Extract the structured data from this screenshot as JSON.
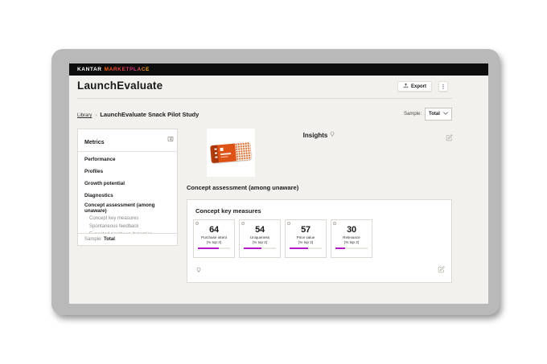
{
  "topbar": {
    "brand_primary": "KANTAR",
    "brand_secondary": "MARKETPLACE"
  },
  "header": {
    "title": "LaunchEvaluate",
    "export_label": "Export",
    "menu_glyph": "⋮"
  },
  "breadcrumb": {
    "library": "Library",
    "separator": "›",
    "current": "LaunchEvaluate Snack Pilot Study"
  },
  "sample_selector": {
    "label": "Sample:",
    "value": "Total"
  },
  "sidebar": {
    "title": "Metrics",
    "items": [
      {
        "label": "Performance"
      },
      {
        "label": "Profiles"
      },
      {
        "label": "Growth potential"
      },
      {
        "label": "Diagnostics"
      },
      {
        "label": "Concept assessment (among unaware)"
      }
    ],
    "subitems": [
      "Concept key measures",
      "Spontaneous feedback",
      "Expected purchase dynamics"
    ],
    "sample_label": "Sample:",
    "sample_value": "Total"
  },
  "insights": {
    "title": "Insights"
  },
  "section": {
    "heading": "Concept assessment (among unaware)"
  },
  "key_measures": {
    "heading": "Concept key measures",
    "metrics": [
      {
        "value": "64",
        "label": "Purchase intent",
        "sublabel": "(% top 2)",
        "pct": 64
      },
      {
        "value": "54",
        "label": "Uniqueness",
        "sublabel": "(% top 2)",
        "pct": 54
      },
      {
        "value": "57",
        "label": "Price value",
        "sublabel": "(% top 2)",
        "pct": 57
      },
      {
        "value": "30",
        "label": "Relevance",
        "sublabel": "(% top 2)",
        "pct": 30
      }
    ]
  },
  "icons": {
    "export": "upload-icon",
    "menu": "kebab-icon",
    "dropdown": "chevron-down-icon",
    "sidebar_header": "collapse-panel-icon",
    "insights": "lightbulb-icon",
    "edit": "edit-pencil-square-icon",
    "tile_marker": "circle-indicator-icon"
  },
  "colors": {
    "accent_magenta": "#b41bc8",
    "topbar_black": "#0d0d0d",
    "frame_gray": "#b9b9b9",
    "screen_background": "#f2f1ed",
    "brand_gradient_start": "#ff6a00",
    "brand_gradient_mid": "#d6308f",
    "brand_gradient_end": "#ffc400",
    "product_orange": "#dd5316"
  }
}
